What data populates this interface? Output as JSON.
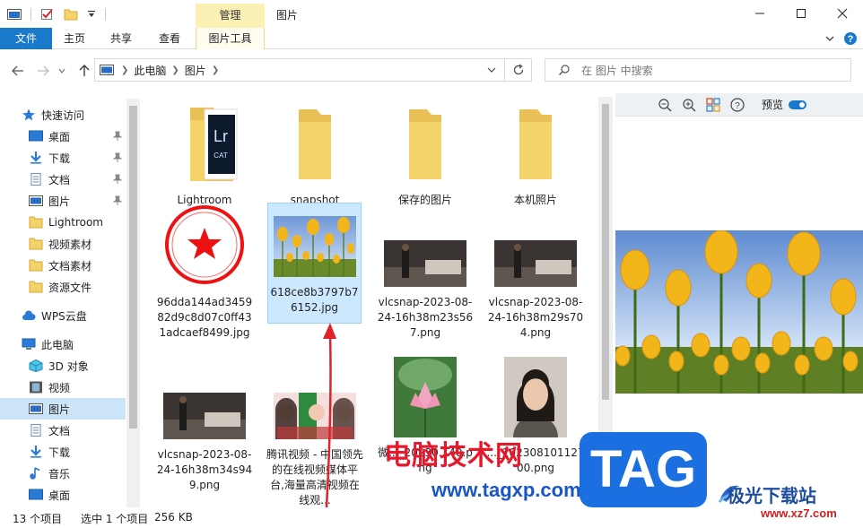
{
  "titlebar": {
    "manage_tab": "管理",
    "window_title": "图片"
  },
  "ribbon": {
    "tabs": [
      "文件",
      "主页",
      "共享",
      "查看",
      "图片工具"
    ]
  },
  "address": {
    "crumbs": [
      "此电脑",
      "图片"
    ],
    "search_placeholder": "在 图片 中搜索"
  },
  "sidebar": {
    "quick_access": "快速访问",
    "quick_items": [
      "桌面",
      "下载",
      "文档",
      "图片",
      "Lightroom",
      "视频素材",
      "文档素材",
      "资源文件"
    ],
    "wps": "WPS云盘",
    "this_pc": "此电脑",
    "pc_items": [
      "3D 对象",
      "视频",
      "图片",
      "文档",
      "下载",
      "音乐",
      "桌面"
    ]
  },
  "files": [
    {
      "name": "Lightroom",
      "type": "folder-lr"
    },
    {
      "name": "snapshot",
      "type": "folder"
    },
    {
      "name": "保存的图片",
      "type": "folder"
    },
    {
      "name": "本机照片",
      "type": "folder"
    },
    {
      "name": "96dda144ad345982d9c8d07c0ff431adcaef8499.jpg",
      "type": "seal"
    },
    {
      "name": "618ce8b3797b76152.jpg",
      "type": "tulip"
    },
    {
      "name": "vlcsnap-2023-08-24-16h38m23s567.png",
      "type": "video"
    },
    {
      "name": "vlcsnap-2023-08-24-16h38m29s704.png",
      "type": "video"
    },
    {
      "name": "vlcsnap-2023-08-24-16h38m34s949.png",
      "type": "video"
    },
    {
      "name": "腾讯视频 - 中国领先的在线视频媒体平台,海量高清视频在线观...",
      "type": "tencent"
    },
    {
      "name": "微..._20230...40.png",
      "type": "lotus"
    },
    {
      "name": "..._20230810112700.png",
      "type": "portrait"
    }
  ],
  "preview": {
    "label": "预览"
  },
  "status": {
    "count": "13 个项目",
    "selected": "选中 1 个项目",
    "size": "256 KB"
  },
  "watermarks": {
    "site_cn": "电脑技术网",
    "site_url": "www.tagxp.com",
    "tag": "TAG",
    "jg_name": "极光下载站",
    "jg_url": "www.xz7.com"
  },
  "colors": {
    "accent": "#1979ca",
    "selection": "#cce8ff",
    "folder": "#f5d36b",
    "manage_tab": "#fbf1b5"
  }
}
